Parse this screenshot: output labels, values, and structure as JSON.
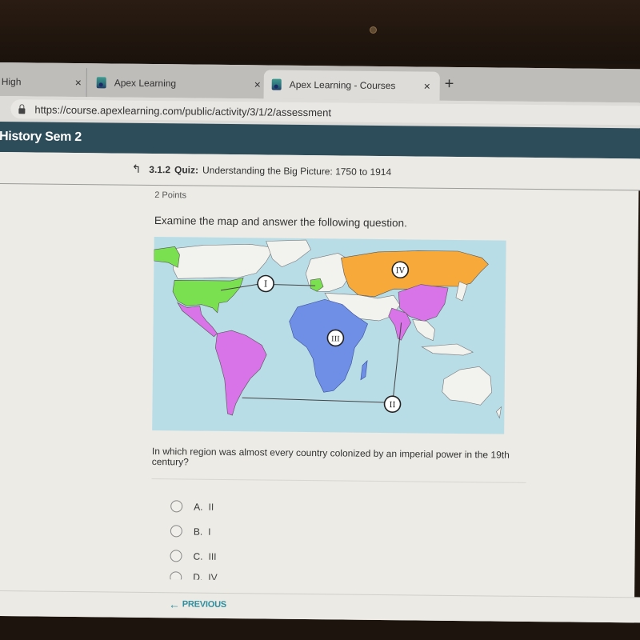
{
  "browser": {
    "tabs": [
      {
        "label": "High",
        "active": false,
        "has_favicon": false
      },
      {
        "label": "Apex Learning",
        "active": false,
        "has_favicon": true
      },
      {
        "label": "Apex Learning - Courses",
        "active": true,
        "has_favicon": true
      }
    ],
    "close_glyph": "×",
    "new_tab_glyph": "+",
    "url": "https://course.apexlearning.com/public/activity/3/1/2/assessment"
  },
  "course": {
    "title": "History Sem 2",
    "bar_color": "#2e4d5a"
  },
  "quiz": {
    "up_glyph": "↰",
    "number": "3.1.2",
    "kind": "Quiz:",
    "title": "Understanding the Big Picture: 1750 to 1914",
    "points": "2 Points",
    "instruction": "Examine the map and answer the following question."
  },
  "map": {
    "colors": {
      "ocean": "#b9dde6",
      "land": "#f2f2ef",
      "green": "#7be04f",
      "pink": "#d873e8",
      "blue": "#6f8fe6",
      "orange": "#f7a93a"
    },
    "labels": [
      {
        "id": "I",
        "text": "I",
        "region": "USA and France"
      },
      {
        "id": "II",
        "text": "II",
        "region": "South America and South Asia"
      },
      {
        "id": "III",
        "text": "III",
        "region": "Africa"
      },
      {
        "id": "IV",
        "text": "IV",
        "region": "Russia"
      }
    ]
  },
  "question": {
    "text": "In which region was almost every country colonized by an imperial power in the 19th century?",
    "choices": [
      {
        "letter": "A.",
        "value": "II"
      },
      {
        "letter": "B.",
        "value": "I"
      },
      {
        "letter": "C.",
        "value": "III"
      },
      {
        "letter": "D.",
        "value": "IV"
      }
    ]
  },
  "footer": {
    "previous_label": "PREVIOUS",
    "previous_arrow": "←",
    "link_color": "#2f8f9f"
  }
}
